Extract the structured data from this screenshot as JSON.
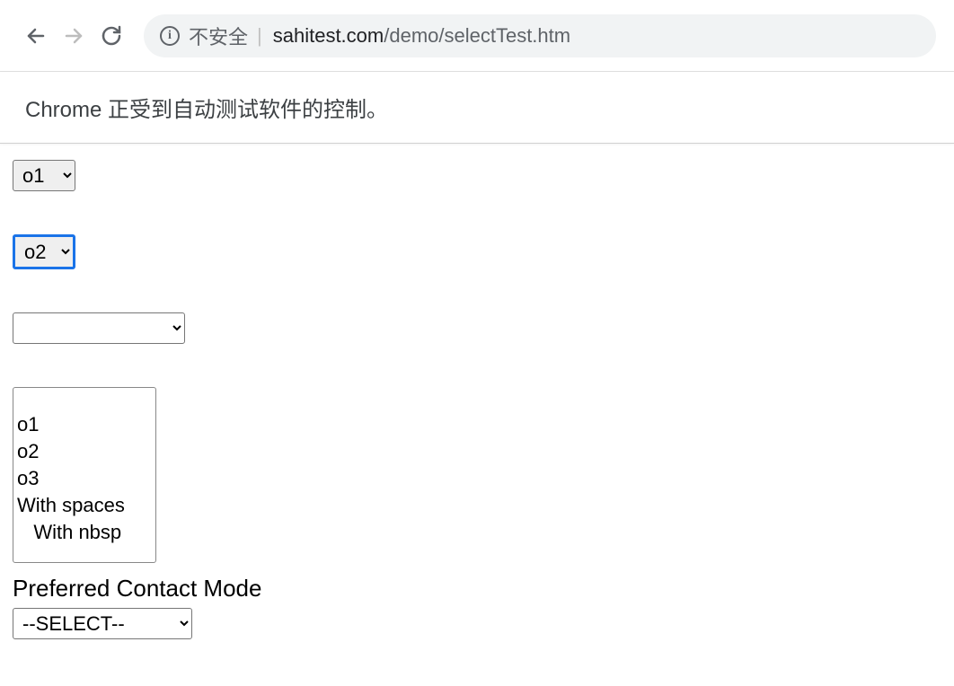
{
  "browser": {
    "insecure_label": "不安全",
    "url_host": "sahitest.com",
    "url_path": "/demo/selectTest.htm"
  },
  "automation_banner": "Chrome 正受到自动测试软件的控制。",
  "select1": {
    "selected": "o1"
  },
  "select2": {
    "selected": "o2"
  },
  "select3": {
    "selected": ""
  },
  "multi_select": {
    "blank": "",
    "options": [
      "o1",
      "o2",
      "o3",
      "With spaces",
      "   With nbsp"
    ]
  },
  "preferred_contact": {
    "label": "Preferred Contact Mode",
    "selected": "--SELECT--"
  }
}
